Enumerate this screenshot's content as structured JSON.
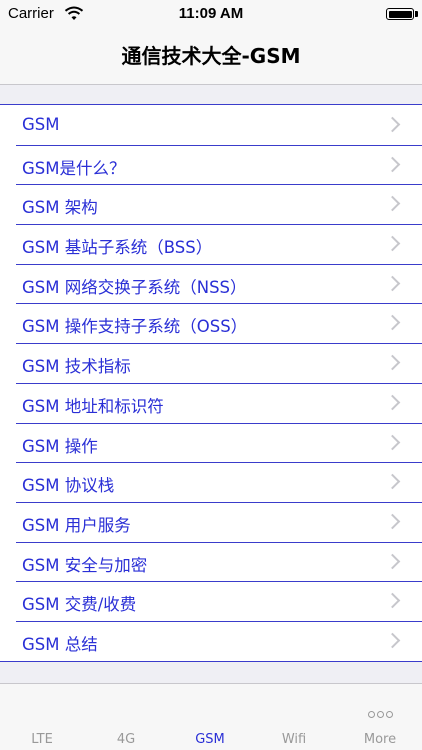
{
  "status": {
    "carrier": "Carrier",
    "time": "11:09 AM"
  },
  "header": {
    "title": "通信技术大全-GSM"
  },
  "list": {
    "items": [
      "GSM",
      "GSM是什么？",
      "GSM 架构",
      "GSM 基站子系统（BSS）",
      "GSM 网络交换子系统（NSS）",
      "GSM 操作支持子系统（OSS）",
      "GSM 技术指标",
      "GSM 地址和标识符",
      "GSM 操作",
      "GSM 协议栈",
      "GSM 用户服务",
      "GSM 安全与加密",
      "GSM 交费/收费",
      "GSM 总结"
    ]
  },
  "tabs": {
    "items": [
      "LTE",
      "4G",
      "GSM",
      "Wifi",
      "More"
    ],
    "active": "GSM"
  },
  "colors": {
    "accent": "#2a2fd6",
    "separator": "#3a3ccb"
  }
}
